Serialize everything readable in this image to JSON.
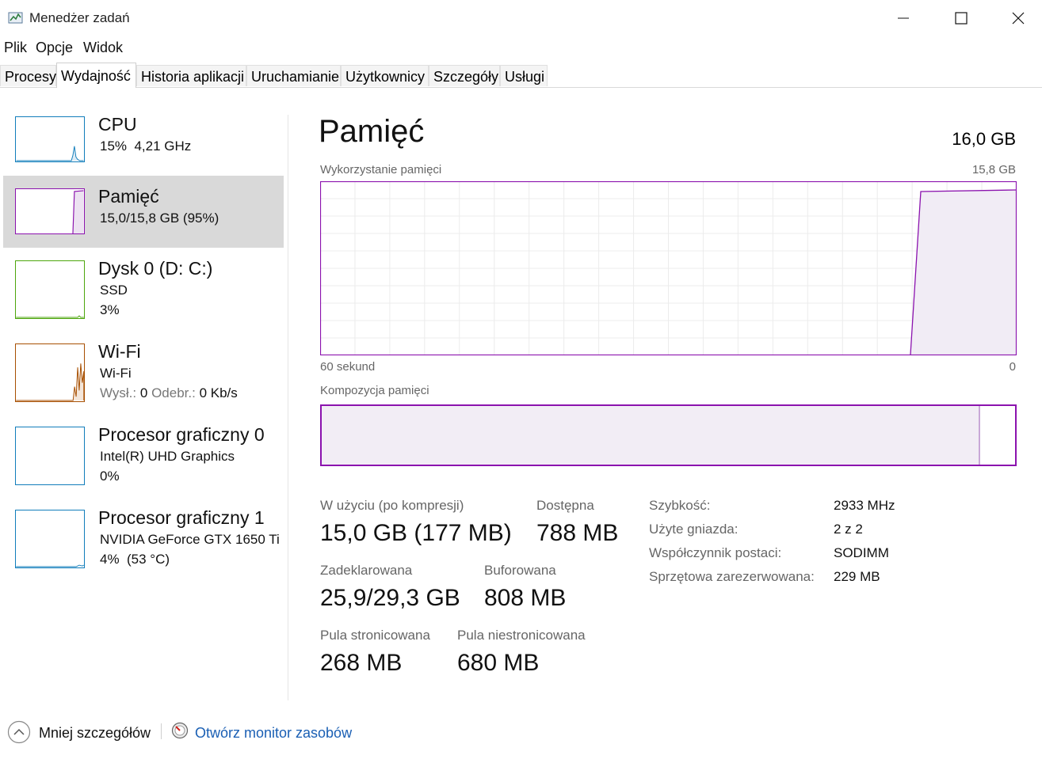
{
  "window": {
    "title": "Menedżer zadań",
    "minimize_glyph": "—",
    "maximize_glyph": "☐",
    "close_glyph": "✕"
  },
  "menu": [
    "Plik",
    "Opcje",
    "Widok"
  ],
  "tabs": [
    {
      "label": "Procesy",
      "active": false
    },
    {
      "label": "Wydajność",
      "active": true
    },
    {
      "label": "Historia aplikacji",
      "active": false
    },
    {
      "label": "Uruchamianie",
      "active": false
    },
    {
      "label": "Użytkownicy",
      "active": false
    },
    {
      "label": "Szczegóły",
      "active": false
    },
    {
      "label": "Usługi",
      "active": false
    }
  ],
  "sidebar": {
    "items": [
      {
        "title": "CPU",
        "line1": "15%  4,21 GHz",
        "color": "#117dbb",
        "selected": false
      },
      {
        "title": "Pamięć",
        "line1": "15,0/15,8 GB (95%)",
        "color": "#8b12ae",
        "selected": true
      },
      {
        "title": "Dysk 0 (D: C:)",
        "line1": "SSD",
        "line2": "3%",
        "color": "#4da60c",
        "selected": false
      },
      {
        "title": "Wi-Fi",
        "line1": "Wi-Fi",
        "line2_parts": [
          "Wysł.:",
          "0",
          "Odebr.:",
          "0 Kb/s"
        ],
        "color": "#a74f01",
        "selected": false
      },
      {
        "title": "Procesor graficzny 0",
        "line1": "Intel(R) UHD Graphics",
        "line2": "0%",
        "color": "#117dbb",
        "selected": false
      },
      {
        "title": "Procesor graficzny 1",
        "line1": "NVIDIA GeForce GTX 1650 Ti",
        "line2": "4%  (53 °C)",
        "color": "#117dbb",
        "selected": false
      }
    ]
  },
  "main": {
    "title": "Pamięć",
    "total": "16,0 GB",
    "usage_chart": {
      "label": "Wykorzystanie pamięci",
      "max_label": "15,8 GB",
      "x_left": "60 sekund",
      "x_right": "0"
    },
    "composition": {
      "label": "Kompozycja pamięci",
      "in_use_fraction": 0.95
    },
    "stats": {
      "in_use_label": "W użyciu (po kompresji)",
      "in_use_value": "15,0 GB (177 MB)",
      "available_label": "Dostępna",
      "available_value": "788 MB",
      "committed_label": "Zadeklarowana",
      "committed_value": "25,9/29,3 GB",
      "cached_label": "Buforowana",
      "cached_value": "808 MB",
      "paged_label": "Pula stronicowana",
      "paged_value": "268 MB",
      "nonpaged_label": "Pula niestronicowana",
      "nonpaged_value": "680 MB"
    },
    "details": [
      {
        "label": "Szybkość:",
        "value": "2933 MHz"
      },
      {
        "label": "Użyte gniazda:",
        "value": "2 z 2"
      },
      {
        "label": "Współczynnik postaci:",
        "value": "SODIMM"
      },
      {
        "label": "Sprzętowa zarezerwowana:",
        "value": "229 MB"
      }
    ]
  },
  "bottom": {
    "less_details": "Mniej szczegółów",
    "open_monitor": "Otwórz monitor zasobów"
  },
  "colors": {
    "memory": "#8b12ae",
    "cpu": "#117dbb",
    "disk": "#4da60c",
    "wifi": "#a74f01",
    "link": "#1a5fb4"
  }
}
